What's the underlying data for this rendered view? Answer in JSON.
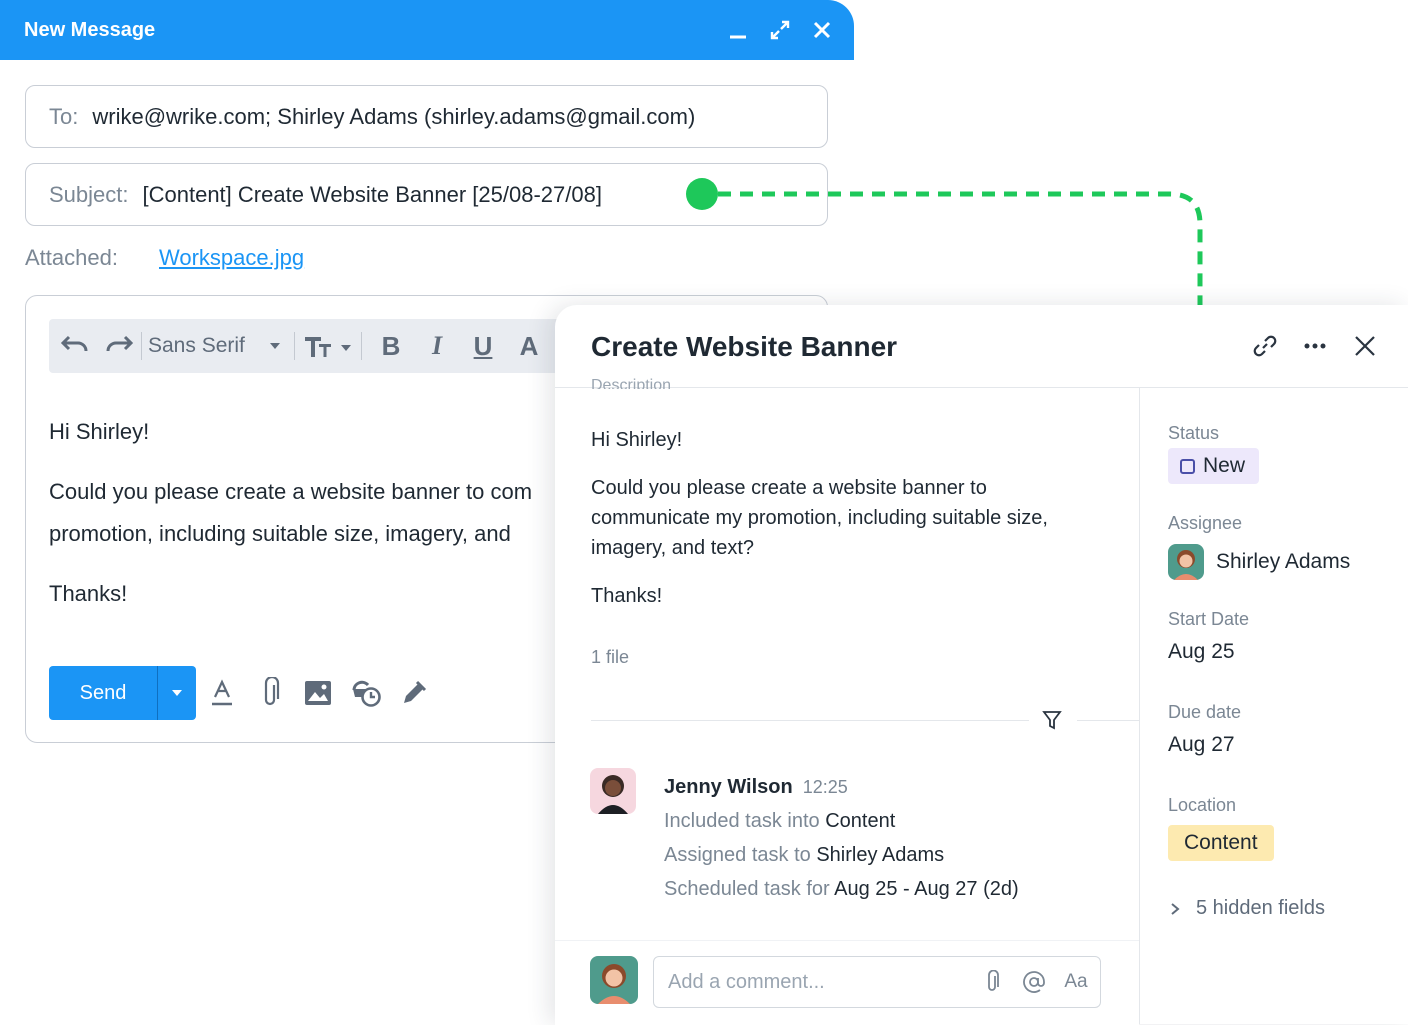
{
  "compose": {
    "title": "New Message",
    "to_label": "To:",
    "to_value": "wrike@wrike.com; Shirley Adams (shirley.adams@gmail.com)",
    "subject_label": "Subject:",
    "subject_value": "[Content] Create Website Banner [25/08-27/08]",
    "attached_label": "Attached:",
    "attached_file": "Workspace.jpg",
    "font_name": "Sans Serif",
    "body": {
      "greeting": "Hi Shirley!",
      "line1": "Could you please create a website banner to com",
      "line2": "promotion, including suitable size, imagery, and",
      "signoff": "Thanks!"
    },
    "send_label": "Send",
    "colors": {
      "header": "#1b95f5",
      "accent": "#1b95f5"
    }
  },
  "connector": {
    "color": "#1ec85a"
  },
  "task": {
    "title": "Create Website Banner",
    "description_label": "Description",
    "description": {
      "greeting": "Hi Shirley!",
      "body": "Could you please create a website banner to communicate my promotion, including suitable size, imagery, and text?",
      "signoff": "Thanks!"
    },
    "file_count": "1 file",
    "activity": {
      "user": "Jenny Wilson",
      "time": "12:25",
      "entries": [
        {
          "action": "Included task into",
          "target": "Content"
        },
        {
          "action": "Assigned task to",
          "target": "Shirley Adams"
        },
        {
          "action": "Scheduled task for",
          "target": "Aug 25 - Aug 27 (2d)"
        }
      ]
    },
    "comment_placeholder": "Add a comment...",
    "comment_format_label": "Aa",
    "fields": {
      "status_label": "Status",
      "status_value": "New",
      "assignee_label": "Assignee",
      "assignee_value": "Shirley Adams",
      "start_label": "Start Date",
      "start_value": "Aug 25",
      "due_label": "Due date",
      "due_value": "Aug 27",
      "location_label": "Location",
      "location_value": "Content",
      "hidden_fields": "5 hidden fields"
    },
    "colors": {
      "status_bg": "#ede8fb",
      "location_bg": "#fdeab0"
    }
  }
}
